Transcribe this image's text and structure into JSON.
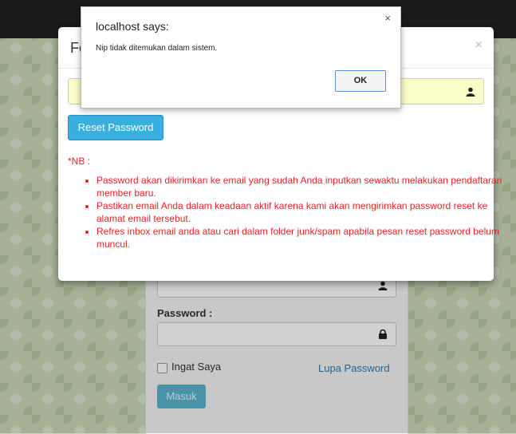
{
  "alert": {
    "title": "localhost says:",
    "message": "Nip tidak ditemukan dalam sistem.",
    "ok_label": "OK",
    "close_glyph": "×"
  },
  "modal": {
    "title": "Fo",
    "close_glyph": "×",
    "input_icon": "user-icon",
    "reset_button_label": "Reset Password",
    "nb_label": "*NB :",
    "notes": [
      "Password akan dikirimkan ke email yang sudah Anda inputkan sewaktu melakukan pendaftaran member baru.",
      "Pastikan email Anda dalam keadaan aktif karena kami akan mengirimkan password reset ke alamat email tersebut.",
      "Refres inbox email anda atau cari dalam folder junk/spam apabila pesan reset password belum muncul."
    ]
  },
  "login": {
    "password_label": "Password :",
    "remember_label": "Ingat Saya",
    "forgot_link": "Lupa Password",
    "submit_label": "Masuk"
  },
  "colors": {
    "accent": "#3aaedf",
    "warning_text": "#e8232b",
    "highlight_input": "#fbfdc8"
  }
}
